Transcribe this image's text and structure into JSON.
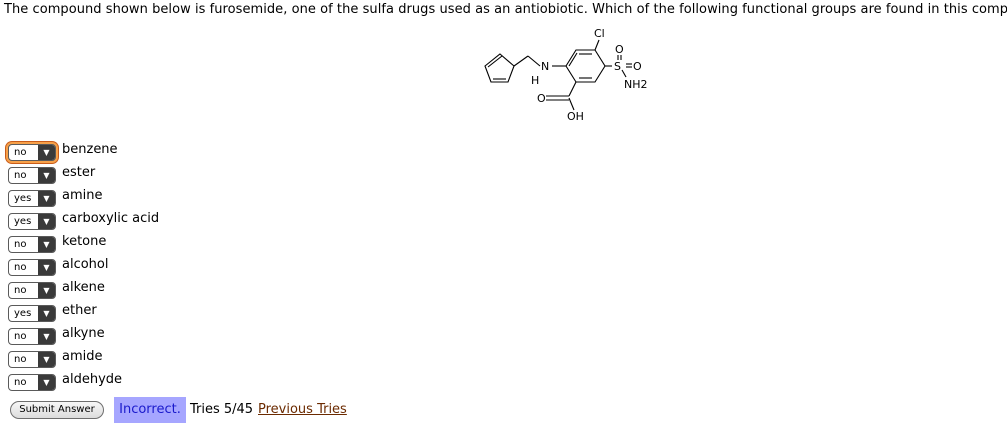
{
  "question": "The compound shown below is furosemide, one of the sulfa drugs used as an antiobiotic. Which of the following functional groups are found in this compound?",
  "molecule": {
    "atoms": [
      "Cl",
      "O",
      "S",
      "O",
      "NH2",
      "N",
      "H",
      "O",
      "OH"
    ]
  },
  "options": [
    {
      "value": "no",
      "label": "benzene",
      "focused": true
    },
    {
      "value": "no",
      "label": "ester"
    },
    {
      "value": "yes",
      "label": "amine"
    },
    {
      "value": "yes",
      "label": "carboxylic acid"
    },
    {
      "value": "no",
      "label": "ketone"
    },
    {
      "value": "no",
      "label": "alcohol"
    },
    {
      "value": "no",
      "label": "alkene"
    },
    {
      "value": "yes",
      "label": "ether"
    },
    {
      "value": "no",
      "label": "alkyne"
    },
    {
      "value": "no",
      "label": "amide"
    },
    {
      "value": "no",
      "label": "aldehyde"
    }
  ],
  "submit_label": "Submit Answer",
  "status": "Incorrect.",
  "tries": "Tries 5/45",
  "previous_tries": "Previous Tries",
  "icons": {
    "dropdown": "chevron-down-icon"
  },
  "colors": {
    "status_bg": "#a6a6ff",
    "status_text": "#1a1acc",
    "focus_ring": "#f7a14a"
  }
}
